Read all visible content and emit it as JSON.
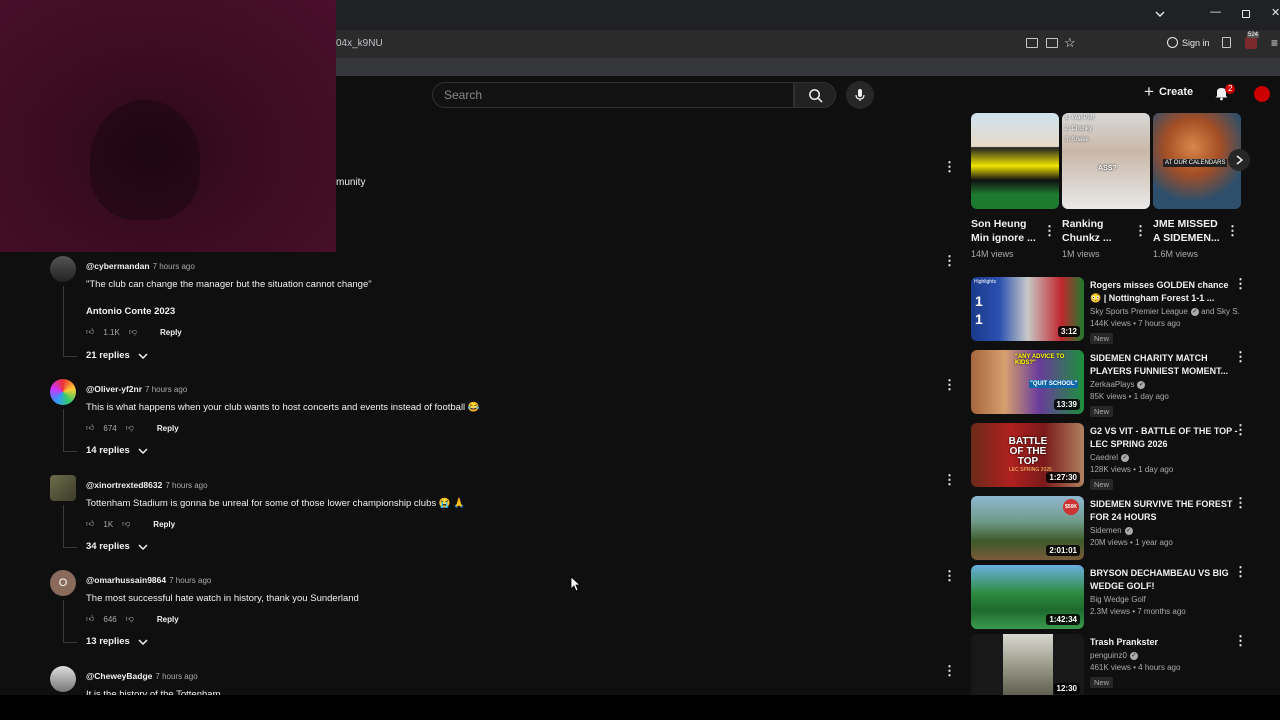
{
  "browser": {
    "url_fragment": "04x_k9NU",
    "sign_in": "Sign in",
    "ext_badge": "524"
  },
  "header": {
    "search_placeholder": "Search",
    "create_label": "Create",
    "notif_count": "2"
  },
  "partial_text": "munity",
  "comments": [
    {
      "user": "@cybermandan",
      "time": "7 hours ago",
      "text": "\"The club can change the manager but the situation cannot change\"",
      "text2": "Antonio Conte 2023",
      "likes": "1.1K",
      "reply": "Reply",
      "replies": "21 replies"
    },
    {
      "user": "@Oliver-yf2nr",
      "time": "7 hours ago",
      "text": "This is what happens when your club wants to host concerts and events instead of football 😂",
      "likes": "674",
      "reply": "Reply",
      "replies": "14 replies"
    },
    {
      "user": "@xinortrexted8632",
      "time": "7 hours ago",
      "text": "Tottenham Stadium is gonna be unreal for some of those lower championship clubs 😭 🙏",
      "likes": "1K",
      "reply": "Reply",
      "replies": "34 replies"
    },
    {
      "user": "@omarhussain9864",
      "time": "7 hours ago",
      "text": "The most successful hate watch in history, thank you Sunderland",
      "likes": "646",
      "reply": "Reply",
      "replies": "13 replies",
      "avatar_letter": "O"
    },
    {
      "user": "@CheweyBadge",
      "time": "7 hours ago",
      "text": "It is the history of the Tottenham"
    }
  ],
  "shorts": [
    {
      "title": "Son Heung Min ignore ...",
      "views": "14M views"
    },
    {
      "title": "Ranking Chunkz ...",
      "views": "1M views",
      "overlay1": "1. Wal Puff",
      "overlay2": "2. Chunky",
      "overlay3": "3. Snake",
      "overlay4": "ASS?"
    },
    {
      "title": "JME MISSED A SIDEMEN...",
      "views": "1.6M views",
      "overlay1": "AT OUR CALENDARS"
    }
  ],
  "videos": [
    {
      "title": "Rogers misses GOLDEN chance 😳 | Nottingham Forest 1-1 ...",
      "channel": "Sky Sports Premier League",
      "channel2": "and Sky S...",
      "meta": "144K views • 7 hours ago",
      "badge": "New",
      "duration": "3:12",
      "thumb_label": "Highlights",
      "score1": "1",
      "score2": "1"
    },
    {
      "title": "SIDEMEN CHARITY MATCH PLAYERS FUNNIEST MOMENT...",
      "channel": "ZerkaaPlays",
      "meta": "85K views • 1 day ago",
      "badge": "New",
      "duration": "13:39",
      "thumb_label": "\"ANY ADVICE TO KIDS?\"",
      "thumb_label2": "\"QUIT SCHOOL\""
    },
    {
      "title": "G2 VS VIT - BATTLE OF THE TOP - LEC SPRING 2026",
      "channel": "Caedrel",
      "meta": "128K views • 1 day ago",
      "badge": "New",
      "duration": "1:27:30",
      "thumb_label": "BATTLE OF THE TOP",
      "thumb_label2": "LEC SPRING 2026"
    },
    {
      "title": "SIDEMEN SURVIVE THE FOREST FOR 24 HOURS",
      "channel": "Sidemen",
      "meta": "20M views • 1 year ago",
      "duration": "2:01:01",
      "thumb_label": "$50K"
    },
    {
      "title": "BRYSON DECHAMBEAU VS BIG WEDGE GOLF!",
      "channel": "Big Wedge Golf",
      "meta": "2.3M views • 7 months ago",
      "duration": "1:42:34"
    },
    {
      "title": "Trash Prankster",
      "channel": "penguinz0",
      "meta": "461K views • 4 hours ago",
      "badge": "New",
      "duration": "12:30"
    }
  ],
  "colors": {
    "brand_red": "#ff0000",
    "bg": "#0f0f0f"
  }
}
